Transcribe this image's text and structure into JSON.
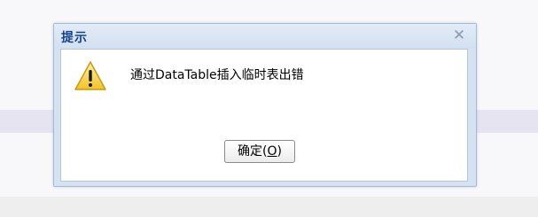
{
  "dialog": {
    "title": "提示",
    "close_icon": "close-icon",
    "icon": "warning-icon",
    "message": "通过DataTable插入临时表出错",
    "ok_button": {
      "label": "确定(",
      "accelerator": "O",
      "label_end": ")"
    }
  }
}
